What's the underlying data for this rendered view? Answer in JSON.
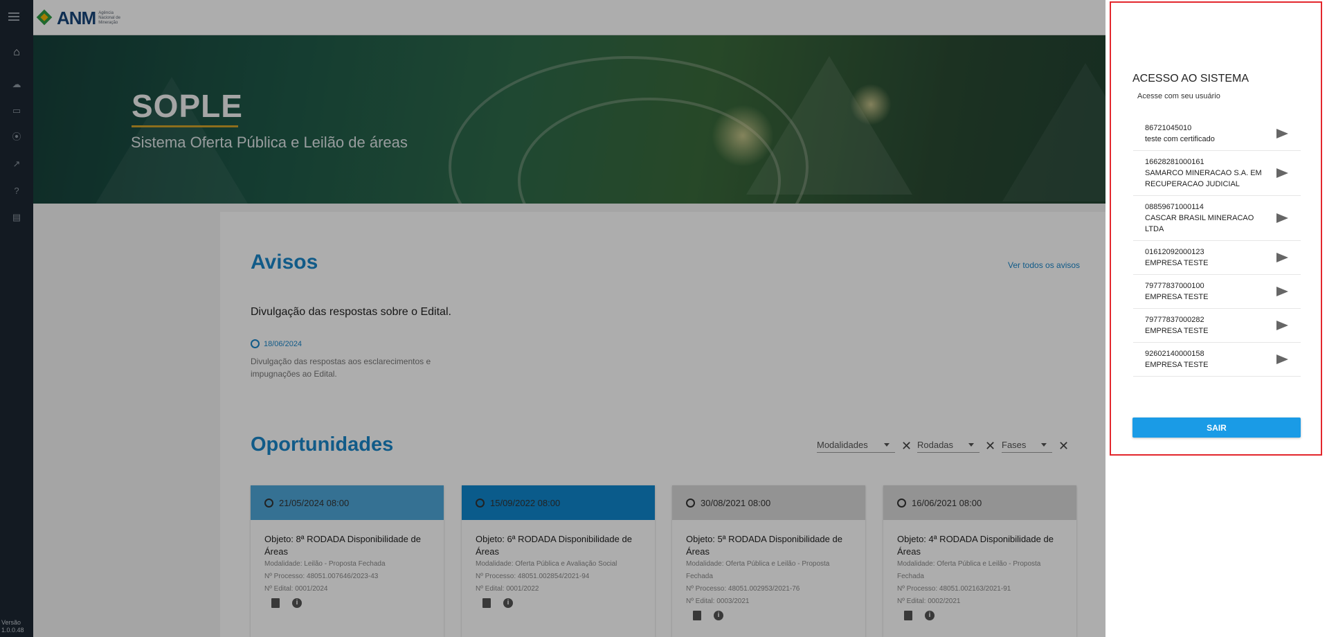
{
  "header": {
    "logo_text": "ANM",
    "logo_subtext": "Agência Nacional de Mineração"
  },
  "rail": {
    "version": "Versão 1.0.0.48"
  },
  "banner": {
    "title": "SOPLE",
    "subtitle": "Sistema Oferta Pública e Leilão de áreas"
  },
  "avisos": {
    "heading": "Avisos",
    "see_all": "Ver todos os avisos",
    "item": {
      "title": "Divulgação das respostas sobre o Edital.",
      "date": "18/06/2024",
      "description": "Divulgação das respostas aos esclarecimentos e impugnações ao Edital."
    }
  },
  "oportunidades": {
    "heading": "Oportunidades",
    "filters": [
      "Modalidades",
      "Rodadas",
      "Fases"
    ],
    "cards": [
      {
        "date": "21/05/2024 08:00",
        "object": "Objeto: 8ª RODADA Disponibilidade de Áreas",
        "modalidade": "Modalidade: Leilão - Proposta Fechada",
        "processo": "Nº Processo: 48051.007646/2023-43",
        "edital": "Nº Edital: 0001/2024",
        "head_color": "#4fa7d9"
      },
      {
        "date": "15/09/2022 08:00",
        "object": "Objeto: 6ª RODADA Disponibilidade de Áreas",
        "modalidade": "Modalidade: Oferta Pública e Avaliação Social",
        "processo": "Nº Processo: 48051.002854/2021-94",
        "edital": "Nº Edital: 0001/2022",
        "head_color": "#0f86cd"
      },
      {
        "date": "30/08/2021 08:00",
        "object": "Objeto: 5ª RODADA Disponibilidade de Áreas",
        "modalidade": "Modalidade: Oferta Pública e Leilão - Proposta Fechada",
        "processo": "Nº Processo: 48051.002953/2021-76",
        "edital": "Nº Edital: 0003/2021",
        "head_color": "#d9d9d9"
      },
      {
        "date": "16/06/2021 08:00",
        "object": "Objeto: 4ª RODADA Disponibilidade de Áreas",
        "modalidade": "Modalidade: Oferta Pública e Leilão - Proposta Fechada",
        "processo": "Nº Processo: 48051.002163/2021-91",
        "edital": "Nº Edital: 0002/2021",
        "head_color": "#d9d9d9"
      }
    ]
  },
  "panel": {
    "title": "ACESSO AO SISTEMA",
    "subtitle": "Acesse com seu usuário",
    "users": [
      {
        "id": "86721045010",
        "name": "teste com certificado"
      },
      {
        "id": "16628281000161",
        "name": "SAMARCO MINERACAO S.A. EM RECUPERACAO JUDICIAL"
      },
      {
        "id": "08859671000114",
        "name": "CASCAR BRASIL MINERACAO LTDA"
      },
      {
        "id": "01612092000123",
        "name": "EMPRESA TESTE"
      },
      {
        "id": "79777837000100",
        "name": "EMPRESA TESTE"
      },
      {
        "id": "79777837000282",
        "name": "EMPRESA TESTE"
      },
      {
        "id": "92602140000158",
        "name": "EMPRESA TESTE"
      }
    ],
    "exit_label": "SAIR"
  },
  "colors": {
    "accent": "#1a86c9",
    "button": "#1a9be6",
    "highlight_border": "#e3262c"
  }
}
